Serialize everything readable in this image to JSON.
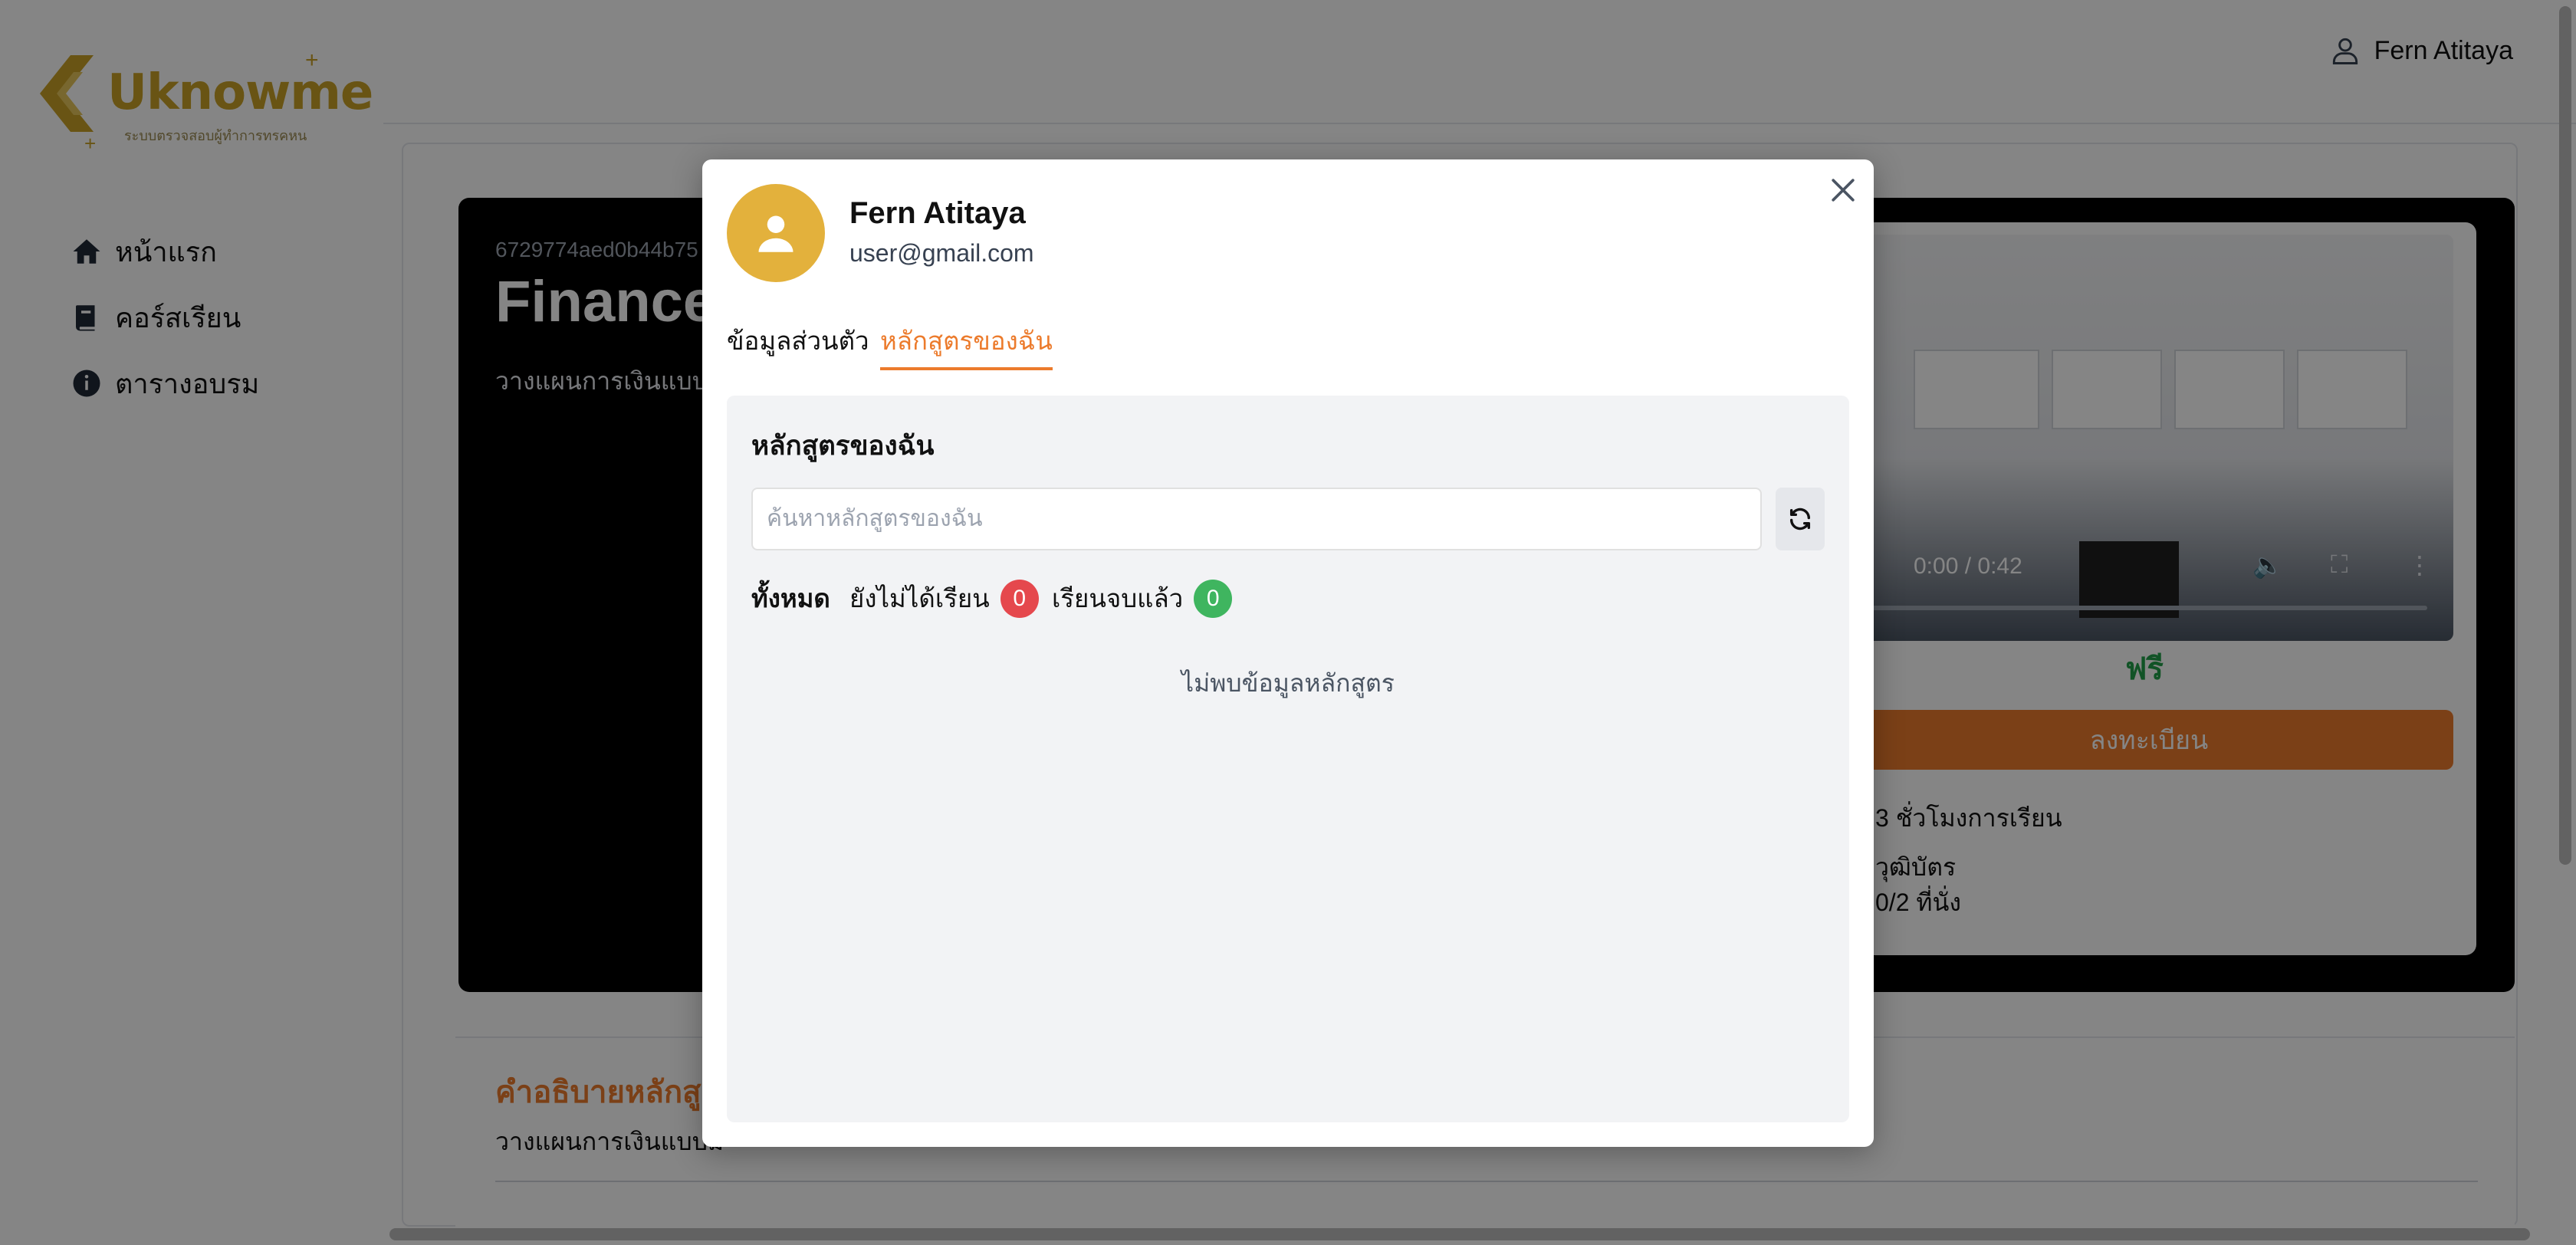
{
  "app": {
    "logo_text": "Uknowme",
    "logo_tagline": "ระบบตรวจสอบผู้ทำการทรคหน"
  },
  "colors": {
    "brand": "#c9a227",
    "accent": "#ec7b2c",
    "success": "#22a04a",
    "danger": "#e5484d"
  },
  "sidebar": {
    "items": [
      {
        "label": "หน้าแรก",
        "icon": "home-icon"
      },
      {
        "label": "คอร์สเรียน",
        "icon": "book-icon"
      },
      {
        "label": "ตารางอบรม",
        "icon": "info-icon"
      }
    ]
  },
  "header": {
    "user_name": "Fern Atitaya",
    "icon": "user-icon"
  },
  "course": {
    "id": "6729774aed0b44b75",
    "title": "Finance",
    "description": "วางแผนการเงินแบบมื",
    "video_time": "0:00 / 0:42",
    "price_label": "ฟรี",
    "enroll_label": "ลงทะเบียน",
    "hours": "3 ชั่วโมงการเรียน",
    "certificate": "วุฒิบัตร",
    "seats": "0/2 ที่นั่ง",
    "desc_heading": "คำอธิบายหลักสูต",
    "desc_text": "วางแผนการเงินแบบมื"
  },
  "modal": {
    "user_name": "Fern Atitaya",
    "email": "user@gmail.com",
    "tabs": [
      {
        "label": "ข้อมูลส่วนตัว",
        "active": false
      },
      {
        "label": "หลักสูตรของฉัน",
        "active": true
      }
    ],
    "panel_title": "หลักสูตรของฉัน",
    "search_placeholder": "ค้นหาหลักสูตรของฉัน",
    "search_value": "",
    "filters": {
      "all": "ทั้งหมด",
      "pending": "ยังไม่ได้เรียน",
      "pending_count": "0",
      "done": "เรียนจบแล้ว",
      "done_count": "0"
    },
    "empty_message": "ไม่พบข้อมูลหลักสูตร"
  }
}
